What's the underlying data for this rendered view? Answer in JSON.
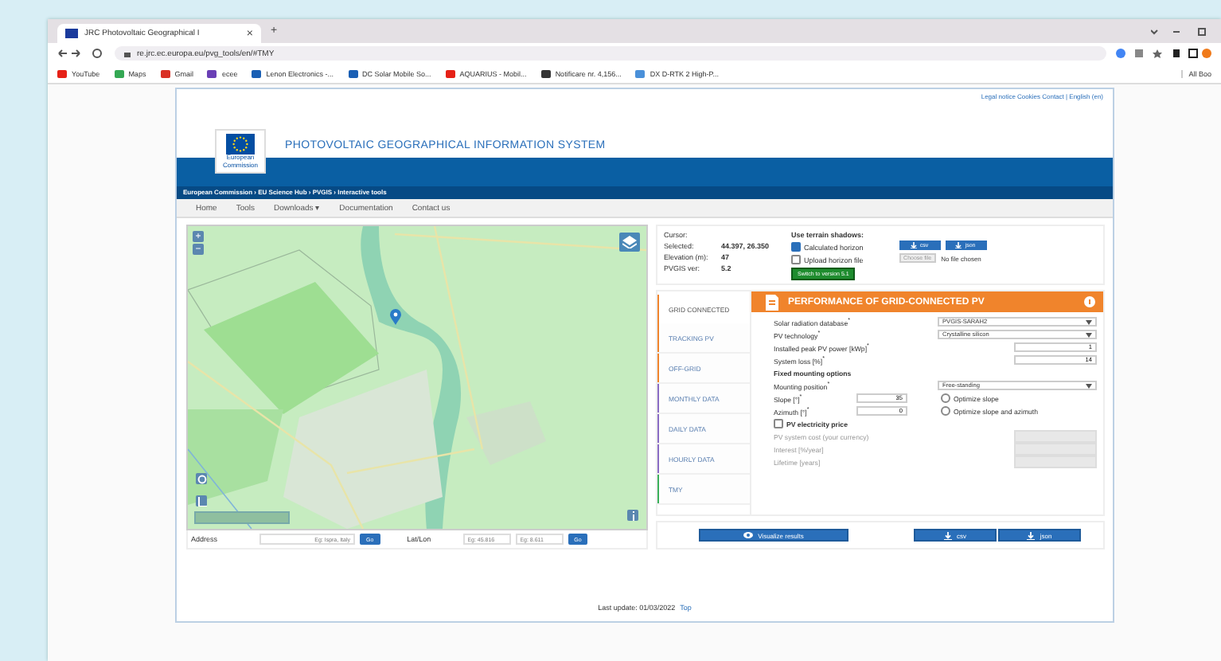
{
  "browser": {
    "tab_title": "JRC Photovoltaic Geographical I",
    "tab_close": "×",
    "new_tab": "+",
    "url": "re.jrc.ec.europa.eu/pvg_tools/en/#TMY",
    "bookmarks": [
      {
        "label": "YouTube",
        "color": "#e62117"
      },
      {
        "label": "Maps",
        "color": "#34a853"
      },
      {
        "label": "Gmail",
        "color": "#d93025"
      },
      {
        "label": "ecee",
        "color": "#6a3fb5"
      },
      {
        "label": "Lenon Electronics -...",
        "color": "#1a5fb4"
      },
      {
        "label": "DC Solar Mobile So...",
        "color": "#1a5fb4"
      },
      {
        "label": "AQUARIUS - Mobil...",
        "color": "#e62117"
      },
      {
        "label": "Notificare nr. 4,156...",
        "color": "#333333"
      },
      {
        "label": "DX D-RTK 2 High-P...",
        "color": "#4a90d9"
      }
    ],
    "all_bookmarks": "All Boo"
  },
  "site": {
    "top_links": "Legal notice  Cookies  Contact | English (en)",
    "logo_text": "European Commission",
    "title": "PHOTOVOLTAIC GEOGRAPHICAL INFORMATION SYSTEM",
    "breadcrumb": "European Commission › EU Science Hub › PVGIS › Interactive tools",
    "nav": [
      {
        "label": "Home"
      },
      {
        "label": "Tools"
      },
      {
        "label": "Downloads ▾"
      },
      {
        "label": "Documentation"
      },
      {
        "label": "Contact us"
      }
    ]
  },
  "map": {
    "zoom_in": "+",
    "zoom_out": "−"
  },
  "search": {
    "address_label": "Address",
    "address_placeholder": "Eg: Ispra, Italy",
    "go": "Go",
    "latlon_label": "Lat/Lon",
    "lat_placeholder": "Eg: 45.816",
    "lon_placeholder": "Eg: 8.611",
    "go2": "Go"
  },
  "info": {
    "cursor": "Cursor:",
    "rows": [
      {
        "label": "Selected:",
        "value": "44.397, 26.350"
      },
      {
        "label": "Elevation (m):",
        "value": "47"
      },
      {
        "label": "PVGIS ver:",
        "value": "5.2"
      }
    ],
    "shadows_title": "Use terrain shadows:",
    "options": [
      {
        "label": "Calculated horizon",
        "checked": true
      },
      {
        "label": "Upload horizon file",
        "checked": false
      }
    ],
    "switch_button": "Switch to version 5.1",
    "csv": "csv",
    "json": "json",
    "choose_file": "Choose file",
    "no_file": "No file chosen"
  },
  "side_tabs": [
    {
      "label": "GRID CONNECTED",
      "selected": true,
      "color": "#f0842c"
    },
    {
      "label": "TRACKING PV",
      "selected": false,
      "color": "#f0842c"
    },
    {
      "label": "OFF-GRID",
      "selected": false,
      "color": "#f0842c"
    },
    {
      "label": "MONTHLY DATA",
      "selected": false,
      "color": "#8a6cc4"
    },
    {
      "label": "DAILY DATA",
      "selected": false,
      "color": "#8a6cc4"
    },
    {
      "label": "HOURLY DATA",
      "selected": false,
      "color": "#8a6cc4"
    },
    {
      "label": "TMY",
      "selected": false,
      "color": "#3bb05a"
    }
  ],
  "panel": {
    "title": "PERFORMANCE OF GRID-CONNECTED PV",
    "rows": [
      {
        "kind": "select",
        "label": "Solar radiation database",
        "mark": "*",
        "value": "PVGIS-SARAH2"
      },
      {
        "kind": "select",
        "label": "PV technology",
        "mark": "*",
        "value": "Crystalline silicon"
      },
      {
        "kind": "input",
        "label": "Installed peak PV power [kWp]",
        "mark": "*",
        "value": "1"
      },
      {
        "kind": "input",
        "label": "System loss [%]",
        "mark": "*",
        "value": "14"
      },
      {
        "kind": "heading",
        "label": "Fixed mounting options"
      },
      {
        "kind": "select",
        "label": "Mounting position",
        "mark": "*",
        "value": "Free-standing"
      },
      {
        "kind": "angle",
        "label": "Slope [°]",
        "mark": "*",
        "value": "35",
        "option": "Optimize slope",
        "checked": false
      },
      {
        "kind": "angle",
        "label": "Azimuth [°]",
        "mark": "*",
        "value": "0",
        "option": "Optimize slope and azimuth",
        "checked": false
      },
      {
        "kind": "check",
        "label": "PV electricity price",
        "checked": false
      },
      {
        "kind": "disabled",
        "label": "PV system cost (your currency)"
      },
      {
        "kind": "disabled",
        "label": "Interest [%/year]"
      },
      {
        "kind": "disabled",
        "label": "Lifetime [years]"
      }
    ]
  },
  "actions": {
    "visualize": "Visualize results",
    "csv": "csv",
    "json": "json"
  },
  "footer": {
    "last_update": "Last update: 01/03/2022",
    "top": "Top"
  }
}
